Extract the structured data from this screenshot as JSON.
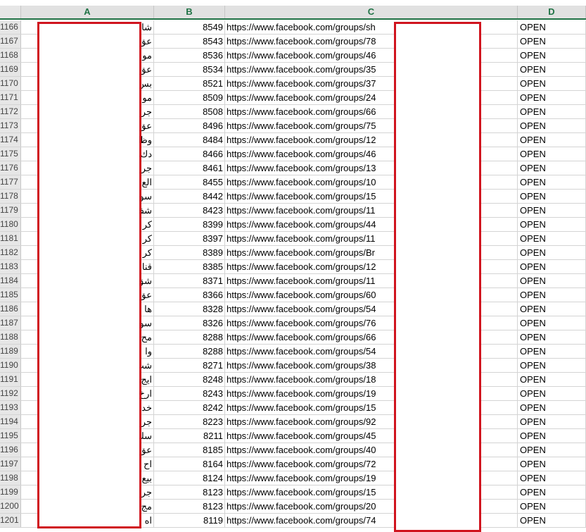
{
  "columns": [
    "A",
    "B",
    "C",
    "D"
  ],
  "rows": [
    {
      "num": "1166",
      "a": "شاقط",
      "b": "8549",
      "c": "https://www.facebook.com/groups/sh",
      "d": "OPEN"
    },
    {
      "num": "1167",
      "a": "عق",
      "b": "8543",
      "c": "https://www.facebook.com/groups/78",
      "d": "OPEN"
    },
    {
      "num": "1168",
      "a": "مو ع والد",
      "b": "8536",
      "c": "https://www.facebook.com/groups/46",
      "d": "OPEN"
    },
    {
      "num": "1169",
      "a": "عق ومص",
      "b": "8534",
      "c": "https://www.facebook.com/groups/35",
      "d": "OPEN"
    },
    {
      "num": "1170",
      "a": "بس",
      "b": "8521",
      "c": "https://www.facebook.com/groups/37",
      "d": "OPEN"
    },
    {
      "num": "1171",
      "a": "مو",
      "b": "8509",
      "c": "https://www.facebook.com/groups/24",
      "d": "OPEN"
    },
    {
      "num": "1172",
      "a": "جر",
      "b": "8508",
      "c": "https://www.facebook.com/groups/66",
      "d": "OPEN"
    },
    {
      "num": "1173",
      "a": "عق يبه",
      "b": "8496",
      "c": "https://www.facebook.com/groups/75",
      "d": "OPEN"
    },
    {
      "num": "1174",
      "a": "وظ",
      "b": "8484",
      "c": "https://www.facebook.com/groups/12",
      "d": "OPEN"
    },
    {
      "num": "1175",
      "a": "دك",
      "b": "8466",
      "c": "https://www.facebook.com/groups/46",
      "d": "OPEN"
    },
    {
      "num": "1176",
      "a": "جر",
      "b": "8461",
      "c": "https://www.facebook.com/groups/13",
      "d": "OPEN"
    },
    {
      "num": "1177",
      "a": "الع",
      "b": "8455",
      "c": "https://www.facebook.com/groups/10",
      "d": "OPEN"
    },
    {
      "num": "1178",
      "a": "سو",
      "b": "8442",
      "c": "https://www.facebook.com/groups/15",
      "d": "OPEN"
    },
    {
      "num": "1179",
      "a": "شف",
      "b": "8423",
      "c": "https://www.facebook.com/groups/11",
      "d": "OPEN"
    },
    {
      "num": "1180",
      "a": "كر",
      "b": "8399",
      "c": "https://www.facebook.com/groups/44",
      "d": "OPEN"
    },
    {
      "num": "1181",
      "a": "كر ، اي",
      "b": "8397",
      "c": "https://www.facebook.com/groups/11",
      "d": "OPEN"
    },
    {
      "num": "1182",
      "a": "كر",
      "b": "8389",
      "c": "https://www.facebook.com/groups/Br",
      "d": "OPEN"
    },
    {
      "num": "1183",
      "a": "قنا",
      "b": "8385",
      "c": "https://www.facebook.com/groups/12",
      "d": "OPEN"
    },
    {
      "num": "1184",
      "a": "شق",
      "b": "8371",
      "c": "https://www.facebook.com/groups/11",
      "d": "OPEN"
    },
    {
      "num": "1185",
      "a": "عق برام",
      "b": "8366",
      "c": "https://www.facebook.com/groups/60",
      "d": "OPEN"
    },
    {
      "num": "1186",
      "a": "ها ليهم",
      "b": "8328",
      "c": "https://www.facebook.com/groups/54",
      "d": "OPEN"
    },
    {
      "num": "1187",
      "a": "سو",
      "b": "8326",
      "c": "https://www.facebook.com/groups/76",
      "d": "OPEN"
    },
    {
      "num": "1188",
      "a": "مح",
      "b": "8288",
      "c": "https://www.facebook.com/groups/66",
      "d": "OPEN"
    },
    {
      "num": "1189",
      "a": "وا",
      "b": "8288",
      "c": "https://www.facebook.com/groups/54",
      "d": "OPEN"
    },
    {
      "num": "1190",
      "a": "شب",
      "b": "8271",
      "c": "https://www.facebook.com/groups/38",
      "d": "OPEN"
    },
    {
      "num": "1191",
      "a": "ايج",
      "b": "8248",
      "c": "https://www.facebook.com/groups/18",
      "d": "OPEN"
    },
    {
      "num": "1192",
      "a": "ارخ",
      "b": "8243",
      "c": "https://www.facebook.com/groups/19",
      "d": "OPEN"
    },
    {
      "num": "1193",
      "a": "خد در",
      "b": "8242",
      "c": "https://www.facebook.com/groups/15",
      "d": "OPEN"
    },
    {
      "num": "1194",
      "a": "جر",
      "b": "8223",
      "c": "https://www.facebook.com/groups/92",
      "d": "OPEN"
    },
    {
      "num": "1195",
      "a": "سك له حد",
      "b": "8211",
      "c": "https://www.facebook.com/groups/45",
      "d": "OPEN"
    },
    {
      "num": "1196",
      "a": "عق وسيا",
      "b": "8185",
      "c": "https://www.facebook.com/groups/40",
      "d": "OPEN"
    },
    {
      "num": "1197",
      "a": "اح",
      "b": "8164",
      "c": "https://www.facebook.com/groups/72",
      "d": "OPEN"
    },
    {
      "num": "1198",
      "a": "بيع",
      "b": "8124",
      "c": "https://www.facebook.com/groups/19",
      "d": "OPEN"
    },
    {
      "num": "1199",
      "a": "جر",
      "b": "8123",
      "c": "https://www.facebook.com/groups/15",
      "d": "OPEN"
    },
    {
      "num": "1200",
      "a": "مج",
      "b": "8123",
      "c": "https://www.facebook.com/groups/20",
      "d": "OPEN"
    },
    {
      "num": "1201",
      "a": "اه",
      "b": "8119",
      "c": "https://www.facebook.com/groups/74",
      "d": "OPEN"
    }
  ]
}
